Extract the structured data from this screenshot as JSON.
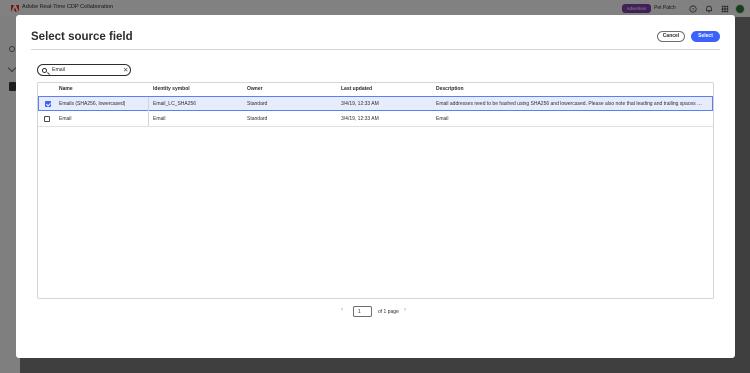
{
  "app": {
    "title": "Adobe Real-Time CDP Collaboration",
    "badge": "Advertiser",
    "org_name": "Pet Patch",
    "header_icons": [
      "help-icon",
      "bell-icon",
      "apps-grid-icon"
    ],
    "brand_color": "#eb1000",
    "badge_color": "#7e3ea5"
  },
  "dialog": {
    "title": "Select source field",
    "cancel_label": "Cancel",
    "select_label": "Select",
    "accent_color": "#3b63fb"
  },
  "search": {
    "value": "Email"
  },
  "table": {
    "columns": [
      "Name",
      "Identity symbol",
      "Owner",
      "Last updated",
      "Description"
    ],
    "rows": [
      {
        "checked": true,
        "name": "Emails (SHA256, lowercased)",
        "identity_symbol": "Email_LC_SHA256",
        "owner": "Standard",
        "last_updated": "3/4/19, 12:33 AM",
        "description": "Email addresses need to be hashed using SHA256 and lowercased. Please also note that leading and trailing spaces need to be trimmed before hashing."
      },
      {
        "checked": false,
        "name": "Email",
        "identity_symbol": "Email",
        "owner": "Standard",
        "last_updated": "3/4/19, 12:33 AM",
        "description": "Email"
      }
    ]
  },
  "pagination": {
    "page": "1",
    "of_text": "of 1 page"
  }
}
